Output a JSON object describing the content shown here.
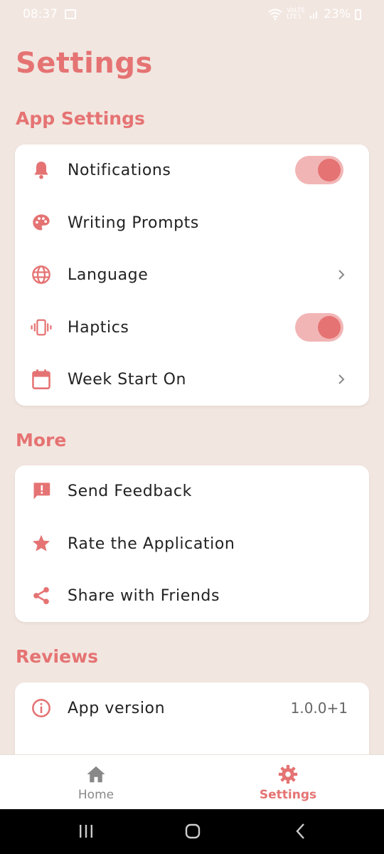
{
  "status_bar": {
    "time": "08:37",
    "net_top": "VoLTE",
    "net_bottom": "LTE1",
    "battery": "23%"
  },
  "page": {
    "title": "Settings"
  },
  "sections": {
    "app_settings": {
      "title": "App Settings",
      "items": [
        {
          "label": "Notifications",
          "icon": "bell-icon",
          "control": "toggle",
          "state": "on"
        },
        {
          "label": "Writing Prompts",
          "icon": "palette-icon",
          "control": "none"
        },
        {
          "label": "Language",
          "icon": "globe-icon",
          "control": "chevron"
        },
        {
          "label": "Haptics",
          "icon": "vibration-icon",
          "control": "toggle",
          "state": "on"
        },
        {
          "label": "Week Start On",
          "icon": "calendar-icon",
          "control": "chevron"
        }
      ]
    },
    "more": {
      "title": "More",
      "items": [
        {
          "label": "Send Feedback",
          "icon": "feedback-icon"
        },
        {
          "label": "Rate the Application",
          "icon": "star-icon"
        },
        {
          "label": "Share with Friends",
          "icon": "share-icon"
        }
      ]
    },
    "reviews": {
      "title": "Reviews",
      "items": [
        {
          "label": "App version",
          "icon": "info-icon",
          "value": "1.0.0+1"
        }
      ]
    }
  },
  "bottom_nav": {
    "items": [
      {
        "label": "Home",
        "icon": "home-icon",
        "active": false
      },
      {
        "label": "Settings",
        "icon": "gear-icon",
        "active": true
      }
    ]
  },
  "colors": {
    "accent": "#e57373",
    "toggle_track": "#f2b5b5",
    "background": "#f2e6e0",
    "card": "#ffffff",
    "text": "#222222"
  }
}
